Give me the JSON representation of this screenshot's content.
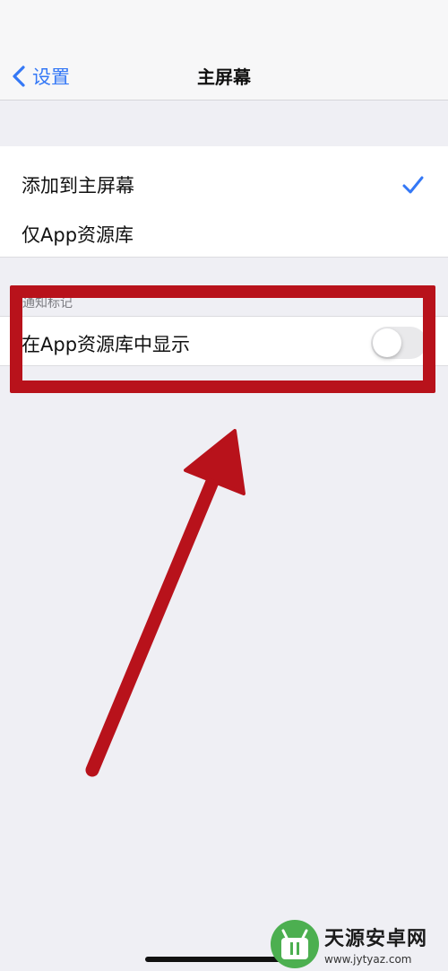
{
  "navbar": {
    "back_label": "设置",
    "title": "主屏幕"
  },
  "new_app_downloads": {
    "options": [
      {
        "label": "添加到主屏幕",
        "selected": true
      },
      {
        "label": "仅App资源库",
        "selected": false
      }
    ]
  },
  "notification_badges": {
    "header": "通知标记",
    "row_label": "在App资源库中显示",
    "toggle_on": false
  },
  "annotation": {
    "highlight_color": "#b8121b",
    "arrow_color": "#b8121b"
  },
  "watermark": {
    "title": "天源安卓网",
    "url": "www.jytyaz.com",
    "brand_color": "#4caf50"
  },
  "colors": {
    "accent": "#3478f6",
    "background": "#efeff4"
  },
  "icons": [
    "chevron-left-icon",
    "checkmark-icon",
    "arrow-annotation",
    "watermark-logo-icon"
  ]
}
